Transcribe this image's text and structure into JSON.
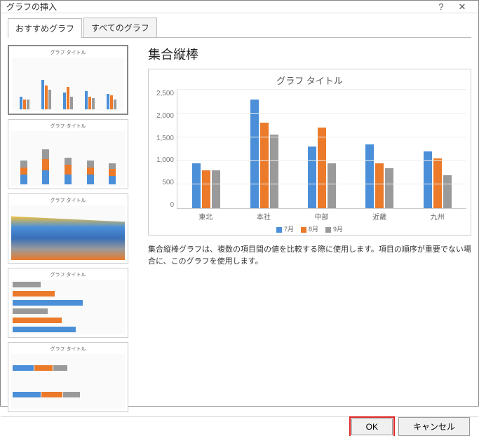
{
  "window": {
    "title": "グラフの挿入"
  },
  "tabs": {
    "recommended": "おすすめグラフ",
    "all": "すべてのグラフ"
  },
  "thumbs": {
    "title": "グラフ タイトル"
  },
  "main": {
    "title": "集合縦棒",
    "chart_title": "グラフ タイトル",
    "legend": [
      "7月",
      "8月",
      "9月"
    ],
    "desc": "集合縦棒グラフは、複数の項目間の値を比較する際に使用します。項目の順序が重要でない場合に、このグラフを使用します。"
  },
  "footer": {
    "ok": "OK",
    "cancel": "キャンセル"
  },
  "chart_data": {
    "type": "bar",
    "title": "グラフ タイトル",
    "categories": [
      "東北",
      "本社",
      "中部",
      "近畿",
      "九州"
    ],
    "series": [
      {
        "name": "7月",
        "values": [
          950,
          2300,
          1300,
          1350,
          1200
        ]
      },
      {
        "name": "8月",
        "values": [
          800,
          1800,
          1700,
          950,
          1050
        ]
      },
      {
        "name": "9月",
        "values": [
          800,
          1550,
          950,
          850,
          700
        ]
      }
    ],
    "ylim": [
      0,
      2500
    ],
    "yticks": [
      0,
      500,
      1000,
      1500,
      2000,
      2500
    ],
    "xlabel": "",
    "ylabel": ""
  }
}
